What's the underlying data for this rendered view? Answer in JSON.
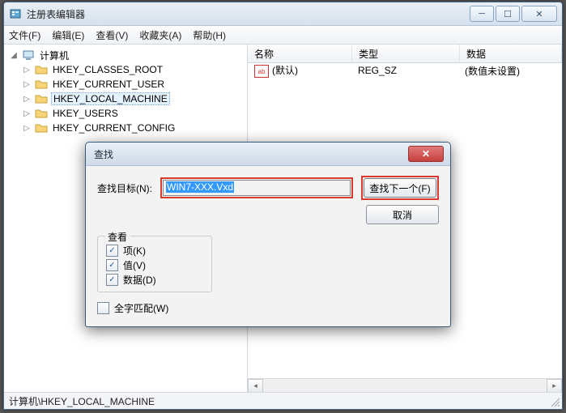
{
  "window": {
    "title": "注册表编辑器"
  },
  "menu": {
    "file": "文件(F)",
    "edit": "编辑(E)",
    "view": "查看(V)",
    "fav": "收藏夹(A)",
    "help": "帮助(H)"
  },
  "tree": {
    "root": "计算机",
    "hkcr": "HKEY_CLASSES_ROOT",
    "hkcu": "HKEY_CURRENT_USER",
    "hklm": "HKEY_LOCAL_MACHINE",
    "hku": "HKEY_USERS",
    "hkcc": "HKEY_CURRENT_CONFIG"
  },
  "list": {
    "headers": {
      "name": "名称",
      "type": "类型",
      "data": "数据"
    },
    "rows": [
      {
        "name": "(默认)",
        "type": "REG_SZ",
        "data": "(数值未设置)"
      }
    ]
  },
  "statusbar": "计算机\\HKEY_LOCAL_MACHINE",
  "dialog": {
    "title": "查找",
    "target_label": "查找目标(N):",
    "target_value": "WIN7-XXX.Vxd",
    "find_next": "查找下一个(F)",
    "cancel": "取消",
    "look_at": "查看",
    "keys": "项(K)",
    "values": "值(V)",
    "data": "数据(D)",
    "whole": "全字匹配(W)"
  }
}
